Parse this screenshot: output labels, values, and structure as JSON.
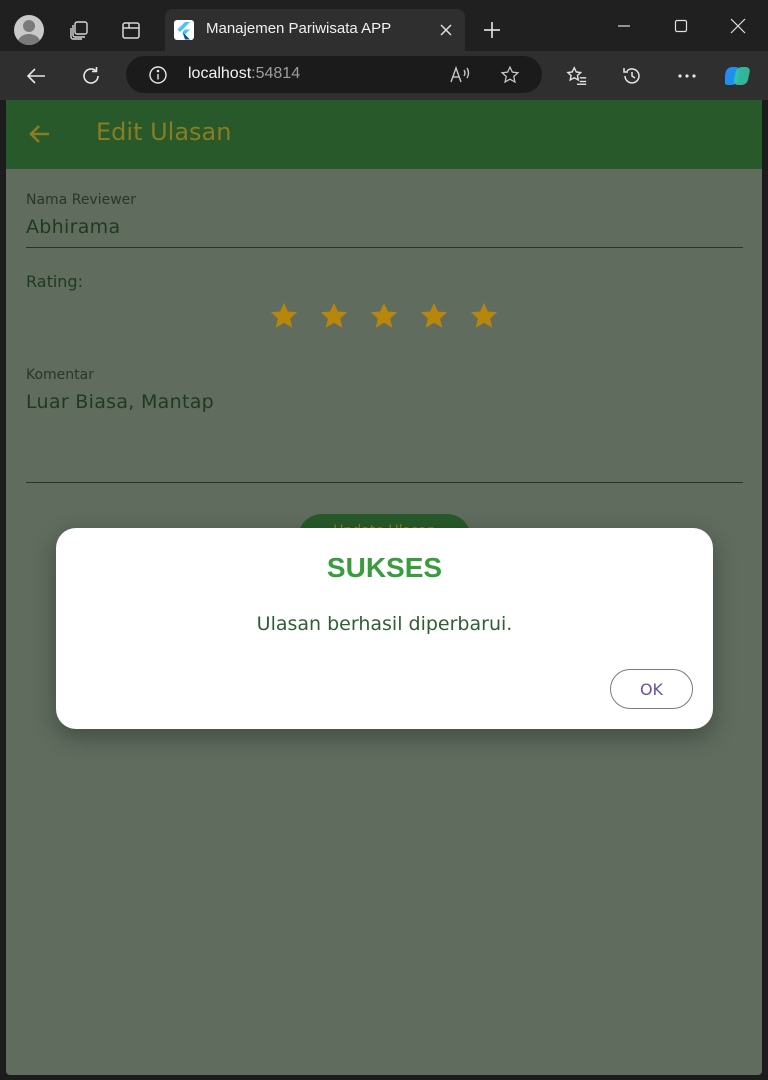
{
  "browser": {
    "tab_title": "Manajemen Pariwisata APP",
    "url_host": "localhost",
    "url_port": ":54814",
    "icons": [
      "profile-avatar",
      "workspaces-icon",
      "tab-actions-icon",
      "close-icon",
      "new-tab-icon",
      "minimize-icon",
      "maximize-icon",
      "window-close-icon",
      "back-icon",
      "refresh-icon",
      "info-icon",
      "read-aloud-icon",
      "favorite-star-icon",
      "favorites-icon",
      "history-icon",
      "more-icon",
      "copilot-icon"
    ]
  },
  "appbar": {
    "title": "Edit Ulasan",
    "back_icon": "arrow-left-icon"
  },
  "form": {
    "reviewer_label": "Nama Reviewer",
    "reviewer_value": "Abhirama",
    "rating_label": "Rating:",
    "rating_value": 5,
    "rating_max": 5,
    "comment_label": "Komentar",
    "comment_value": "Luar Biasa, Mantap",
    "submit_label": "Update Ulasan"
  },
  "dialog": {
    "title": "SUKSES",
    "message": "Ulasan berhasil diperbarui.",
    "ok_label": "OK"
  },
  "colors": {
    "appbar": "#27592a",
    "appbar_text": "#8a7d20",
    "overlay_bg": "#5f6c5e",
    "star": "#b8860b",
    "dialog_title": "#3b9b3f",
    "dialog_text": "#2f5f31",
    "ok_text": "#6b4ea8"
  }
}
